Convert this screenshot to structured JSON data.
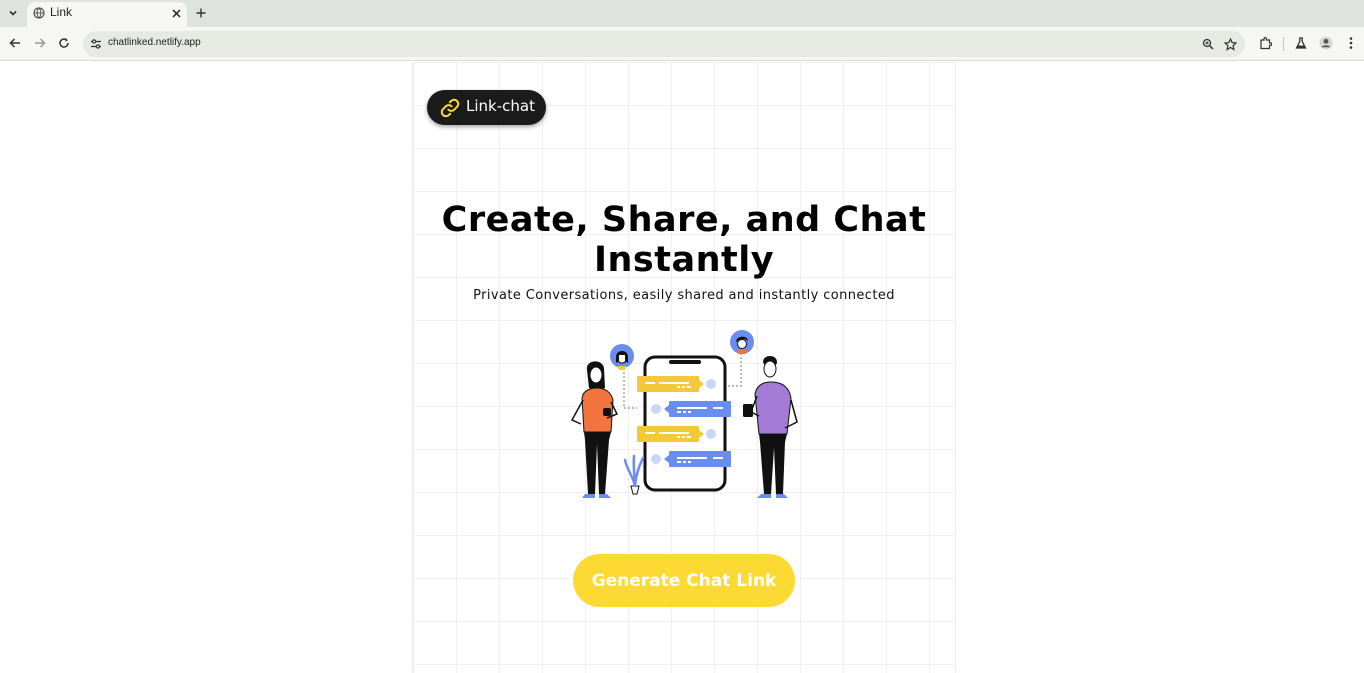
{
  "browser": {
    "tab_title": "Link",
    "url": "chatlinked.netlify.app"
  },
  "page": {
    "logo_text": "Link-chat",
    "headline_line1": "Create, Share, and Chat",
    "headline_line2": "Instantly",
    "subheadline": "Private Conversations, easily shared and instantly connected",
    "cta_label": "Generate Chat Link"
  },
  "colors": {
    "accent_yellow": "#fdda33",
    "logo_bg": "#1b1b1b",
    "chat_blue": "#6a8df0",
    "chat_yellow": "#f3c93a",
    "person_orange": "#f2743f",
    "person_purple": "#a57bd8"
  },
  "icons": [
    "tab-list-icon",
    "globe-icon",
    "close-icon",
    "plus-icon",
    "back-icon",
    "forward-icon",
    "reload-icon",
    "site-settings-icon",
    "zoom-icon",
    "star-icon",
    "extensions-icon",
    "labs-icon",
    "profile-icon",
    "more-icon",
    "link-icon"
  ]
}
